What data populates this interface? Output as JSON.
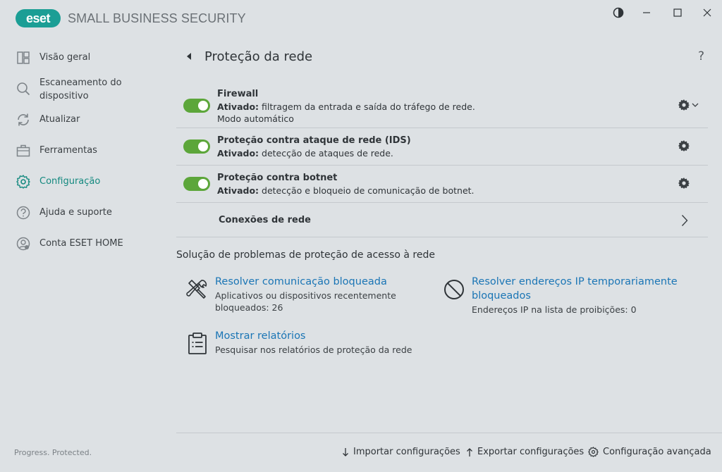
{
  "app": {
    "logo_text": "eset",
    "title": "SMALL BUSINESS SECURITY",
    "brand_color": "#1b9e95"
  },
  "window_controls": [
    "contrast-icon",
    "minimize-icon",
    "maximize-icon",
    "close-icon"
  ],
  "sidebar": {
    "items": [
      {
        "label": "Visão geral",
        "icon": "dashboard-icon",
        "active": false
      },
      {
        "label": "Escaneamento do dispositivo",
        "icon": "search-icon",
        "active": false
      },
      {
        "label": "Atualizar",
        "icon": "refresh-icon",
        "active": false
      },
      {
        "label": "Ferramentas",
        "icon": "briefcase-icon",
        "active": false
      },
      {
        "label": "Configuração",
        "icon": "gear-icon",
        "active": true
      },
      {
        "label": "Ajuda e suporte",
        "icon": "help-icon",
        "active": false
      },
      {
        "label": "Conta ESET HOME",
        "icon": "account-icon",
        "active": false
      }
    ],
    "footer": "Progress. Protected."
  },
  "header": {
    "title": "Proteção da rede",
    "help": "?"
  },
  "features": [
    {
      "title": "Firewall",
      "status_label": "Ativado:",
      "status_text": " filtragem da entrada e saída do tráfego de rede.",
      "extra": "Modo automático",
      "enabled": true
    },
    {
      "title": "Proteção contra ataque de rede (IDS)",
      "status_label": "Ativado:",
      "status_text": " detecção de ataques de rede.",
      "enabled": true
    },
    {
      "title": "Proteção contra botnet",
      "status_label": "Ativado:",
      "status_text": " detecção e bloqueio de comunicação de botnet.",
      "enabled": true
    }
  ],
  "network_connections": {
    "label": "Conexões de rede"
  },
  "troubleshooting": {
    "title": "Solução de problemas de proteção de acesso à rede",
    "tiles": [
      {
        "link_line1": "Resolver comunicação bloqueada",
        "desc_line1": "Aplicativos ou dispositivos recentemente",
        "desc_line2": "bloqueados: 26",
        "icon": "tools-icon"
      },
      {
        "link_line1": "Resolver endereços IP temporariamente",
        "link_line2": "bloqueados",
        "desc_line1": "Endereços IP na lista de proibições: 0",
        "icon": "blocked-icon"
      },
      {
        "link_line1": "Mostrar relatórios",
        "desc_line1": "Pesquisar nos relatórios de proteção da rede",
        "icon": "clipboard-icon"
      }
    ]
  },
  "footer": {
    "import": "Importar configurações",
    "export": "Exportar configurações",
    "advanced": "Configuração avançada"
  },
  "colors": {
    "toggle_on": "#5ca63a",
    "link": "#1a75b5",
    "active_nav": "#14897f",
    "background": "#dde1e4"
  }
}
